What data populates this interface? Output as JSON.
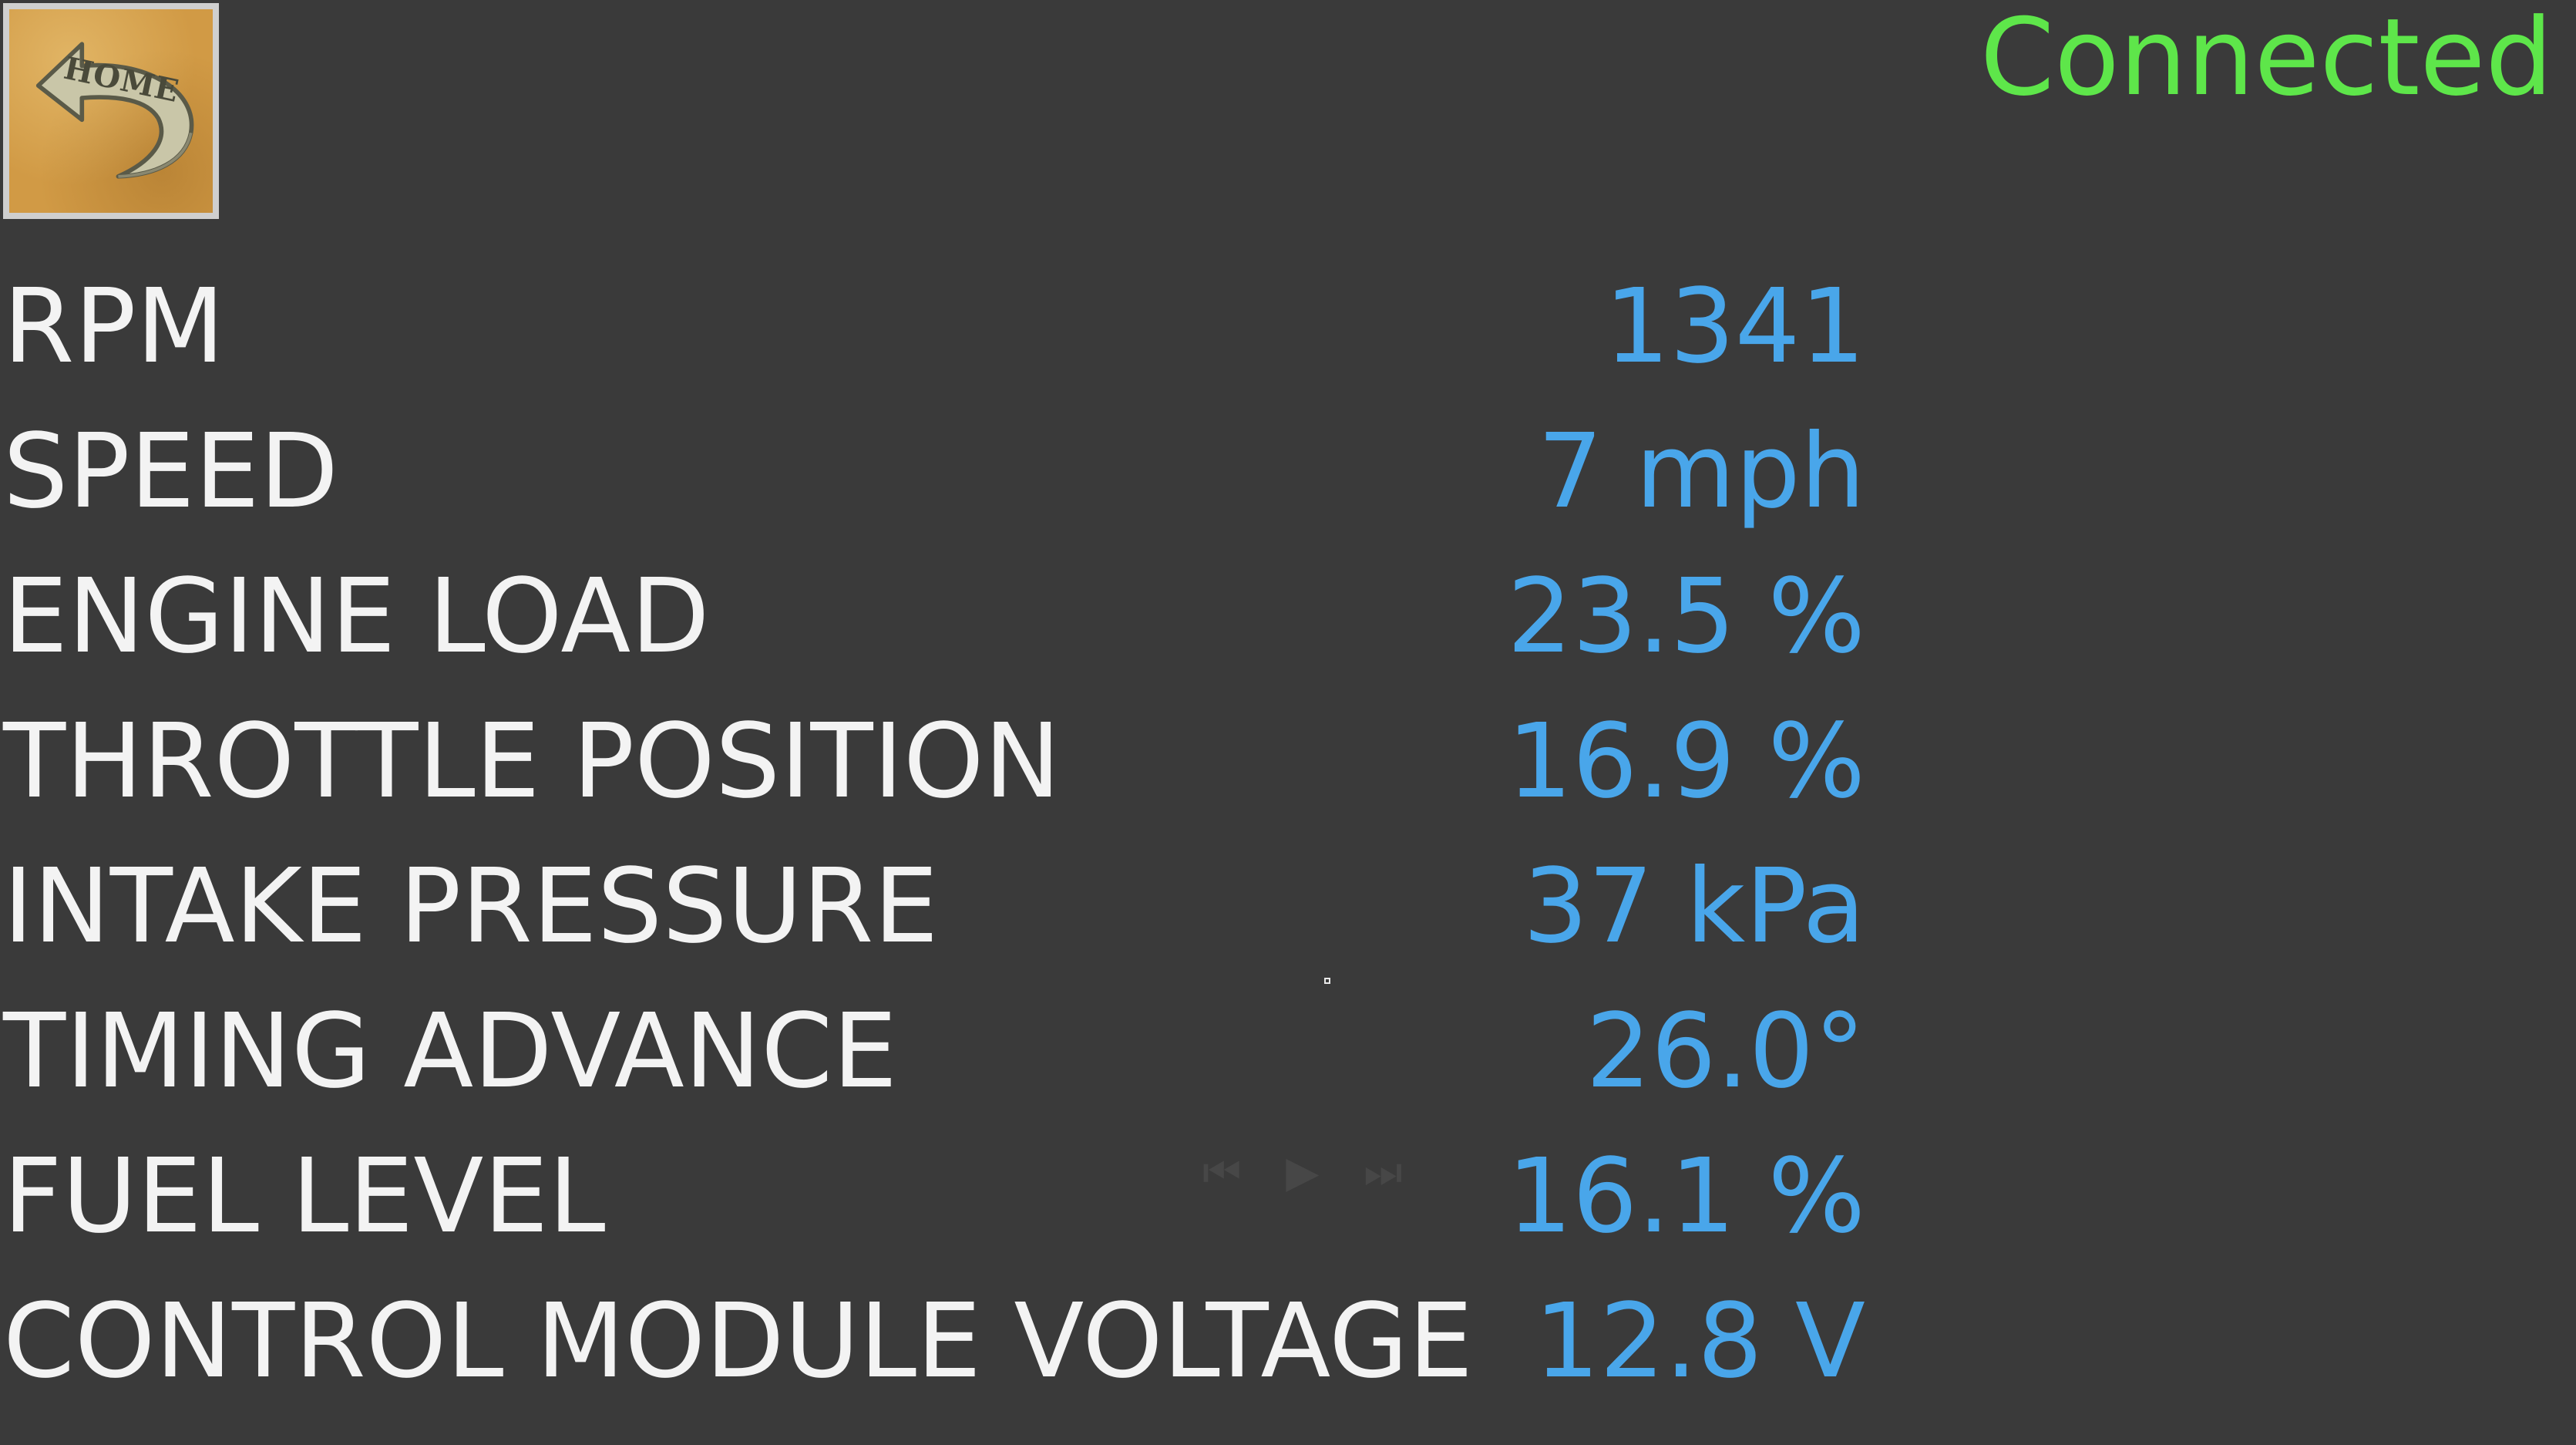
{
  "header": {
    "home_button_label": "HOME",
    "connection_status": "Connected",
    "connection_color": "#5ee64a"
  },
  "colors": {
    "background": "#3a3a3a",
    "label": "#f3f3f3",
    "value": "#49a6ea"
  },
  "icons": {
    "home": "home-arrow-icon",
    "media_controls": "media-controls-icon"
  },
  "readings": [
    {
      "label": "RPM",
      "value": "1341"
    },
    {
      "label": "SPEED",
      "value": "7 mph"
    },
    {
      "label": "ENGINE LOAD",
      "value": "23.5 %"
    },
    {
      "label": "THROTTLE POSITION",
      "value": "16.9 %"
    },
    {
      "label": "INTAKE PRESSURE",
      "value": "37 kPa"
    },
    {
      "label": "TIMING ADVANCE",
      "value": "26.0°"
    },
    {
      "label": "FUEL LEVEL",
      "value": "16.1 %"
    },
    {
      "label": "CONTROL MODULE VOLTAGE",
      "value": "12.8 V"
    }
  ]
}
